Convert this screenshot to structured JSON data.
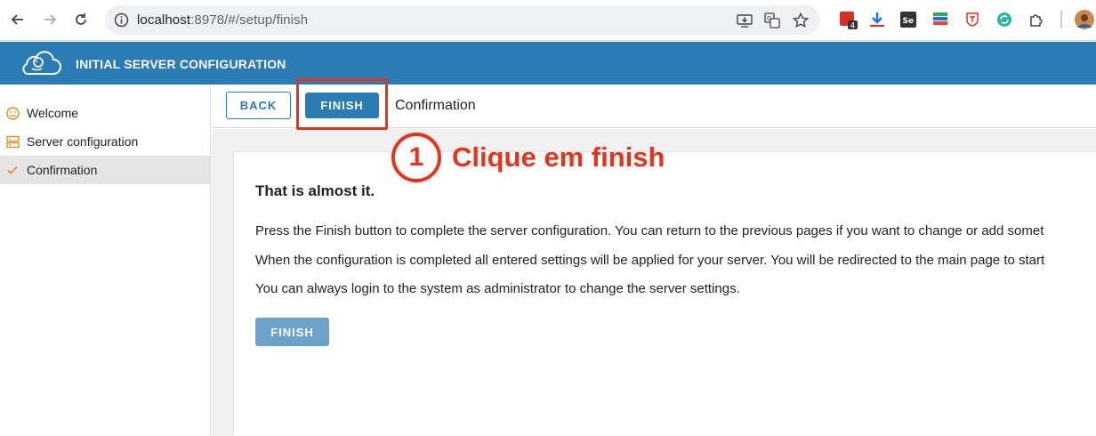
{
  "browser": {
    "url_host": "localhost",
    "url_path": ":8978/#/setup/finish",
    "extension_badge": "4",
    "extension_se": "Se"
  },
  "app": {
    "title": "INITIAL SERVER CONFIGURATION"
  },
  "sidebar": {
    "items": [
      {
        "label": "Welcome",
        "icon": "smiley-icon"
      },
      {
        "label": "Server configuration",
        "icon": "server-icon"
      },
      {
        "label": "Confirmation",
        "icon": "check-icon",
        "active": true
      }
    ]
  },
  "toolbar": {
    "back_label": "BACK",
    "finish_label": "FINISH",
    "page_label": "Confirmation"
  },
  "content": {
    "heading": "That is almost it.",
    "lines": [
      "Press the Finish button to complete the server configuration. You can return to the previous pages if you want to change or add somet",
      "When the configuration is completed all entered settings will be applied for your server. You will be redirected to the main page to start",
      "You can always login to the system as administrator to change the server settings."
    ],
    "finish_label": "FINISH"
  },
  "annotation": {
    "number": "1",
    "text": "Clique em finish",
    "color": "#e5331c"
  },
  "colors": {
    "primary": "#2b7bb5",
    "primary_disabled": "#6ca3cb"
  }
}
